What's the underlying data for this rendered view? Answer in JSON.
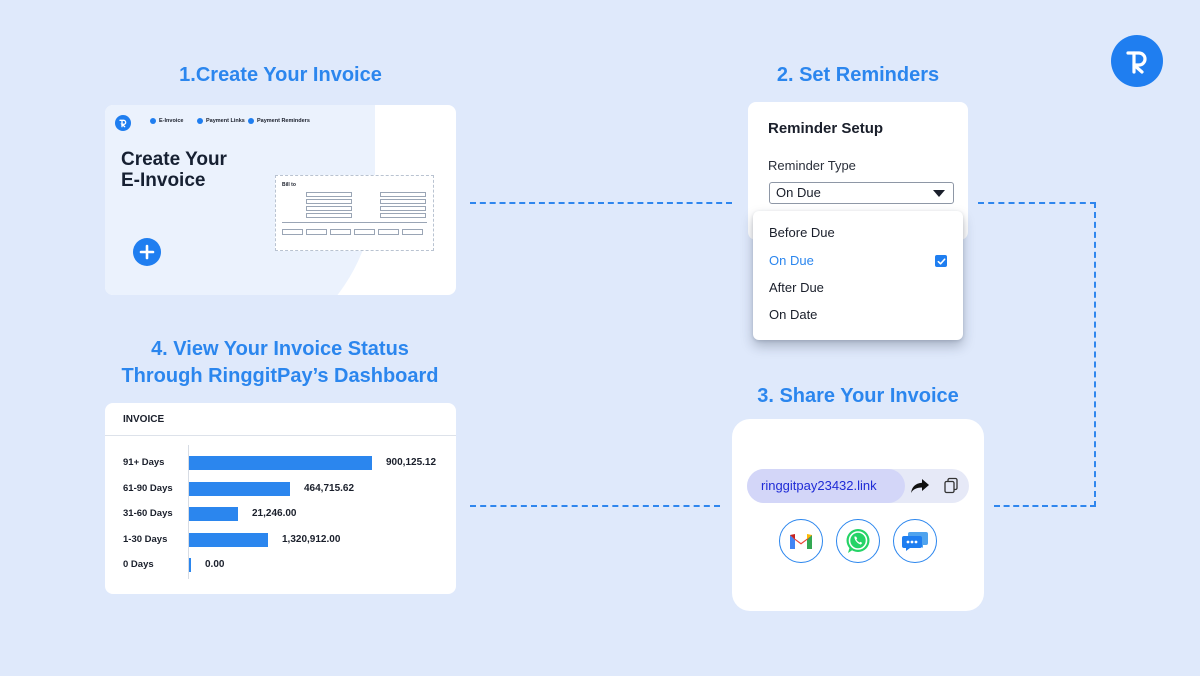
{
  "steps": {
    "create": "1.Create Your Invoice",
    "remind": "2. Set Reminders",
    "share": "3. Share Your Invoice",
    "status_line1": "4. View Your Invoice Status",
    "status_line2": "Through RinggitPay’s Dashboard"
  },
  "create_card": {
    "nav": [
      "E-Invoice",
      "Payment Links",
      "Payment Reminders"
    ],
    "title_line1": "Create Your",
    "title_line2": "E-Invoice",
    "form_title": "Bill to"
  },
  "reminder_card": {
    "title": "Reminder Setup",
    "type_label": "Reminder Type",
    "selected": "On Due",
    "options": [
      "Before Due",
      "On Due",
      "After Due",
      "On Date"
    ]
  },
  "share_card": {
    "link": "ringgitpay23432.link",
    "channels": [
      "gmail-icon",
      "whatsapp-icon",
      "sms-icon"
    ]
  },
  "dashboard": {
    "header": "INVOICE",
    "chart_data": {
      "type": "bar",
      "orientation": "horizontal",
      "categories": [
        "91+ Days",
        "61-90 Days",
        "31-60 Days",
        "1-30 Days",
        "0 Days"
      ],
      "values": [
        900125.12,
        464715.62,
        21246.0,
        1320912.0,
        0.0
      ],
      "value_labels": [
        "900,125.12",
        "464,715.62",
        "21,246.00",
        "1,320,912.00",
        "0.00"
      ],
      "bar_fraction": [
        1.0,
        0.55,
        0.27,
        0.43,
        0.012
      ]
    }
  },
  "colors": {
    "background": "#dfe9fb",
    "accent": "#2b86ee",
    "link_text": "#1f2bd6"
  }
}
